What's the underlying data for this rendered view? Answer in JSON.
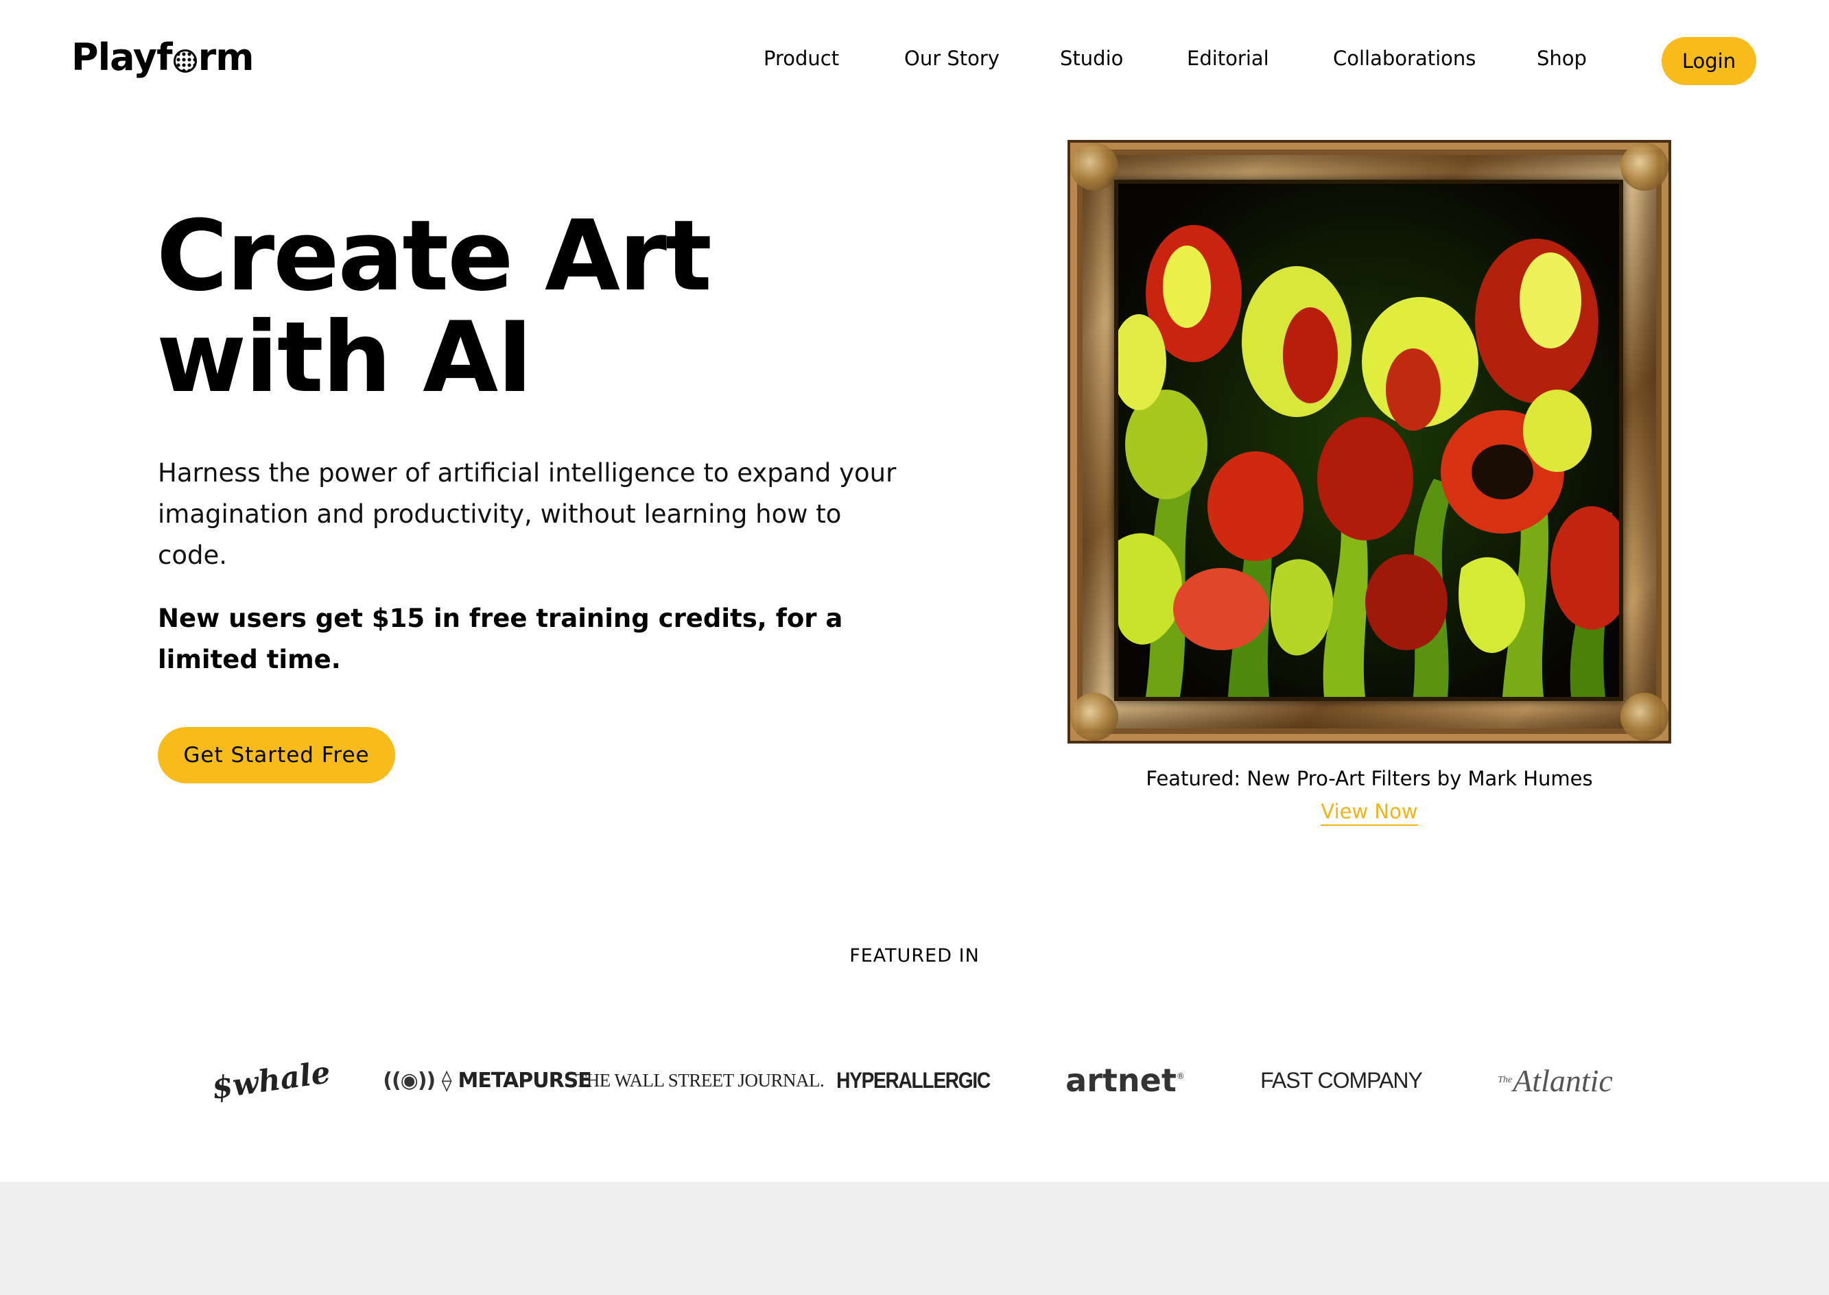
{
  "header": {
    "logo_text": "Playform",
    "logo_prefix": "Playf",
    "logo_suffix": "rm",
    "nav": [
      {
        "label": "Product"
      },
      {
        "label": "Our Story"
      },
      {
        "label": "Studio"
      },
      {
        "label": "Editorial"
      },
      {
        "label": "Collaborations"
      },
      {
        "label": "Shop"
      }
    ],
    "login_label": "Login"
  },
  "hero": {
    "title_line1": "Create Art",
    "title_line2": "with AI",
    "description": "Harness the power of artificial intelligence to expand your imagination and productivity, without learning how to code.",
    "promo": "New users get $15 in free training credits, for a limited time.",
    "cta_label": "Get Started Free"
  },
  "featured_art": {
    "caption": "Featured: New Pro-Art Filters by Mark Humes",
    "link_label": "View Now"
  },
  "press": {
    "heading": "FEATURED IN",
    "logos": [
      {
        "name": "whale-logo",
        "text": "$whale"
      },
      {
        "name": "metapurse-logo",
        "text": "METAPURSE"
      },
      {
        "name": "wsj-logo",
        "text": "THE WALL STREET JOURNAL."
      },
      {
        "name": "hyperallergic-logo",
        "text": "HYPERALLERGIC"
      },
      {
        "name": "artnet-logo",
        "text": "artnet"
      },
      {
        "name": "fast-company-logo",
        "text": "FAST COMPANY"
      },
      {
        "name": "atlantic-logo",
        "text": "Atlantic",
        "prefix": "The"
      }
    ]
  },
  "colors": {
    "accent": "#f7bb1c",
    "link": "#f0b318",
    "band": "#efefef",
    "text": "#000000"
  }
}
